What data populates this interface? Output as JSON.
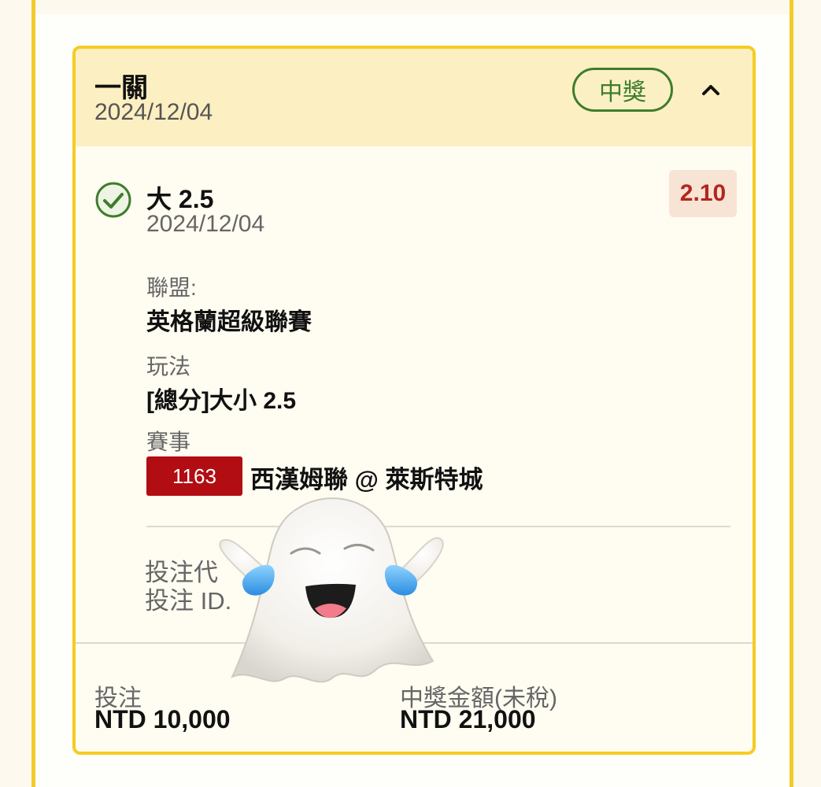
{
  "header": {
    "title": "一關",
    "date": "2024/12/04",
    "status_badge": "中獎",
    "collapse_icon": "chevron-up-icon"
  },
  "selection": {
    "status_icon": "check-circle-icon",
    "title": "大 2.5",
    "date": "2024/12/04",
    "odds": "2.10",
    "league_label": "聯盟:",
    "league_value": "英格蘭超級聯賽",
    "market_label": "玩法",
    "market_value": "[總分]大小 2.5",
    "event_label": "賽事",
    "event_number": "1163",
    "event_name": "西漢姆聯 @ 萊斯特城"
  },
  "bet_meta": {
    "code_label": "投注代",
    "id_label": "投注 ID."
  },
  "footer": {
    "stake_label": "投注",
    "stake_value": "NTD 10,000",
    "payout_label": "中獎金額(未稅)",
    "payout_value": "NTD 21,000"
  },
  "overlay": {
    "sticker": "laughing-ghost-sticker"
  },
  "colors": {
    "accent_yellow": "#f5cc21",
    "header_bg": "#fcefc1",
    "win_green": "#3d7d2d",
    "odds_red": "#b3261e",
    "event_red": "#b10d12"
  }
}
